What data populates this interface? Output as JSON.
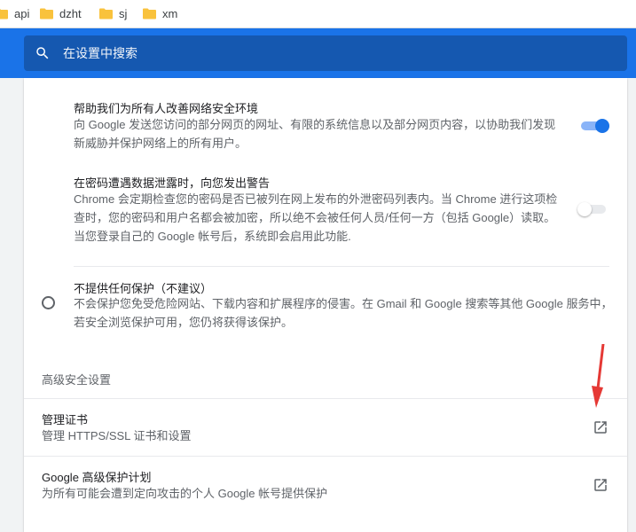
{
  "bookmarks": [
    {
      "label": "api"
    },
    {
      "label": "dzht"
    },
    {
      "label": "sj"
    },
    {
      "label": "xm"
    }
  ],
  "search": {
    "placeholder": "在设置中搜索",
    "value": ""
  },
  "settings": {
    "help_improve": {
      "title": "帮助我们为所有人改善网络安全环境",
      "desc_line1": "向 Google 发送您访问的部分网页的网址、有限的系统信息以及部分网页内容，以协助我们发现",
      "desc_line2": "新威胁并保护网络上的所有用户。",
      "enabled": true
    },
    "password_leak": {
      "title": "在密码遭遇数据泄露时，向您发出警告",
      "desc_line1": "Chrome 会定期检查您的密码是否已被列在网上发布的外泄密码列表内。当 Chrome 进行这项检",
      "desc_line2": "查时，您的密码和用户名都会被加密，所以绝不会被任何人员/任何一方（包括 Google）读取。",
      "desc_line3": "当您登录自己的 Google 帐号后，系统即会启用此功能.",
      "enabled": false
    },
    "no_protection": {
      "title": "不提供任何保护（不建议）",
      "desc_line1": "不会保护您免受危险网站、下载内容和扩展程序的侵害。在 Gmail 和 Google 搜索等其他 Google 服务中，",
      "desc_line2": "若安全浏览保护可用，您仍将获得该保护。",
      "selected": false
    },
    "advanced_section_title": "高级安全设置",
    "manage_certs": {
      "title": "管理证书",
      "desc": "管理 HTTPS/SSL 证书和设置"
    },
    "advanced_protection": {
      "title": "Google 高级保护计划",
      "desc": "为所有可能会遭到定向攻击的个人 Google 帐号提供保护"
    }
  },
  "colors": {
    "accent": "#1a73e8",
    "annotation_arrow": "#e53935"
  },
  "icons": [
    "folder-icon",
    "search-icon",
    "open-in-new-icon"
  ]
}
